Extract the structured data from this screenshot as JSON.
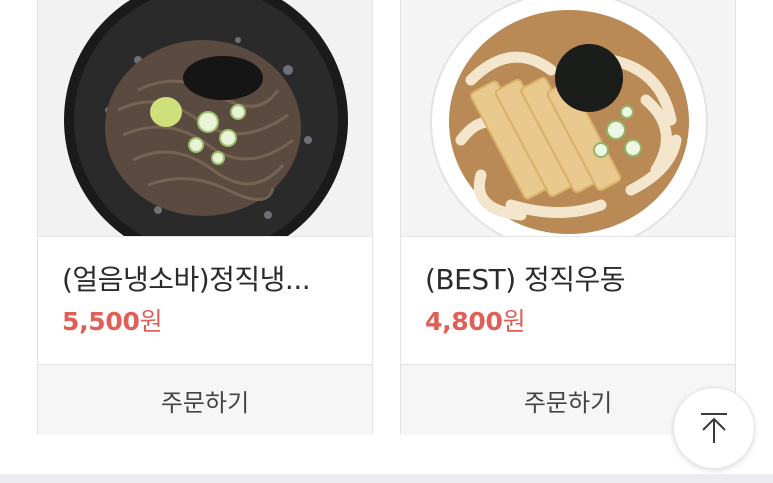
{
  "products": [
    {
      "name": "(얼음냉소바)정직냉...",
      "price_amount": "5,500",
      "price_unit": "원",
      "order_label": "주문하기",
      "image": "soba-noodle-photo"
    },
    {
      "name": "(BEST) 정직우동",
      "price_amount": "4,800",
      "price_unit": "원",
      "order_label": "주문하기",
      "image": "udon-noodle-photo"
    }
  ],
  "scroll_top": {
    "icon": "arrow-up-to-top-icon"
  },
  "colors": {
    "price": "#e06058",
    "order_bg": "#f6f6f7",
    "border": "#e2e2e2"
  }
}
